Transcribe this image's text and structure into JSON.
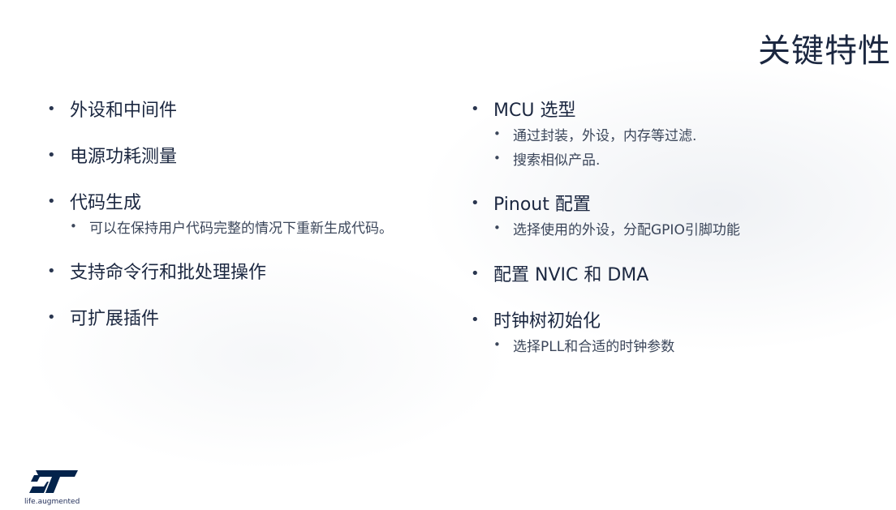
{
  "title": "关键特性",
  "left_items": [
    {
      "label": "外设和中间件",
      "subs": []
    },
    {
      "label": "电源功耗测量",
      "subs": []
    },
    {
      "label": "代码生成",
      "subs": [
        "可以在保持用户代码完整的情况下重新生成代码。"
      ]
    },
    {
      "label": "支持命令行和批处理操作",
      "subs": []
    },
    {
      "label": "可扩展插件",
      "subs": []
    }
  ],
  "right_items": [
    {
      "label": "MCU 选型",
      "subs": [
        "通过封装，外设，内存等过滤.",
        "搜索相似产品."
      ]
    },
    {
      "label": "Pinout 配置",
      "subs": [
        "选择使用的外设，分配GPIO引脚功能"
      ]
    },
    {
      "label": "配置 NVIC 和 DMA",
      "subs": []
    },
    {
      "label": "时钟树初始化",
      "subs": [
        "选择PLL和合适的时钟参数"
      ]
    }
  ],
  "bullet_char": "•",
  "logo": {
    "tagline": "life.augmented",
    "icon": "st-logo-icon",
    "color": "#03234b"
  }
}
